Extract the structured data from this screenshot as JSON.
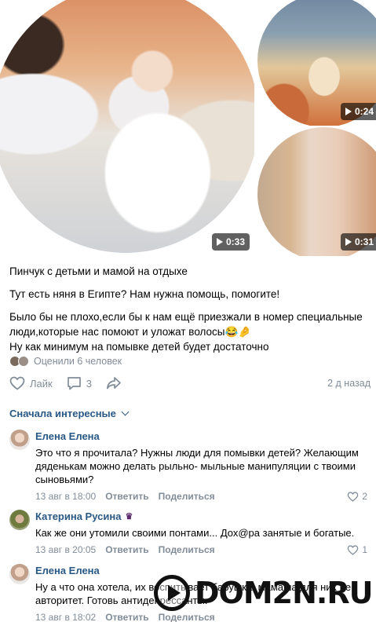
{
  "media": {
    "main_video_duration": "0:33",
    "thumb1_duration": "0:24",
    "thumb2_duration": "0:31"
  },
  "post": {
    "title_line": "Пинчук с детьми и мамой на отдыхе",
    "line2": "Тут есть няня в Египте? Нам нужна помощь, помогите!",
    "line3a": "Было бы не плохо,если бы к нам ещё приезжали в номер специальные",
    "line3b": "люди,которые нас помоют и уложат волосы😂🤌",
    "line3c": "Ну как минимум на помывке детей будет достаточно"
  },
  "rated": {
    "text": "Оценили 6 человек"
  },
  "actions": {
    "like_label": "Лайк",
    "comments_count": "3",
    "date": "2 д назад"
  },
  "sort": {
    "label": "Сначала интересные"
  },
  "comments": [
    {
      "author": "Елена Елена",
      "text": "Это что я прочитала? Нужны люди для помывки детей? Желающим дяденькам можно делать рыльно- мыльные манипуляции с твоими сыновьями?",
      "date": "13 авг в 18:00",
      "reply": "Ответить",
      "share": "Поделиться",
      "likes": "2"
    },
    {
      "author": "Катерина Русина",
      "crown": "♛",
      "text": "Как же они утомили своими понтами... Дох@ра занятые и богатые.",
      "date": "13 авг в 20:05",
      "reply": "Ответить",
      "share": "Поделиться",
      "likes": "1"
    },
    {
      "author": "Елена Елена",
      "text": "Ну а что она хотела, их воспитывает бабушка, мамаша для них не авторитет. Готовь антидепрессанты.",
      "date": "13 авг в 18:02",
      "reply": "Ответить",
      "share": "Поделиться",
      "likes": ""
    }
  ],
  "watermark": {
    "text": "DOM2N.RU"
  },
  "colors": {
    "link": "#2a5885",
    "meta": "#818c99"
  }
}
